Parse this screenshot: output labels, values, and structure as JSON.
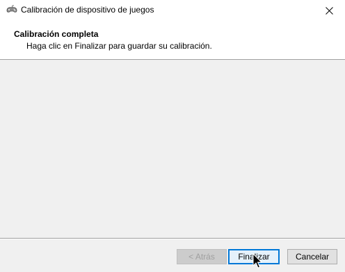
{
  "window": {
    "title": "Calibración de dispositivo de juegos",
    "icon": "gamepad-icon",
    "close_icon": "close-icon"
  },
  "header": {
    "title": "Calibración completa",
    "subtitle": "Haga clic en Finalizar para guardar su calibración."
  },
  "buttons": {
    "back": {
      "label": "< Atrás",
      "enabled": false
    },
    "finish": {
      "label": "Finalizar",
      "focused": true
    },
    "cancel": {
      "label": "Cancelar"
    }
  },
  "colors": {
    "accent": "#0078d7",
    "background": "#f0f0f0",
    "header_background": "#ffffff"
  }
}
